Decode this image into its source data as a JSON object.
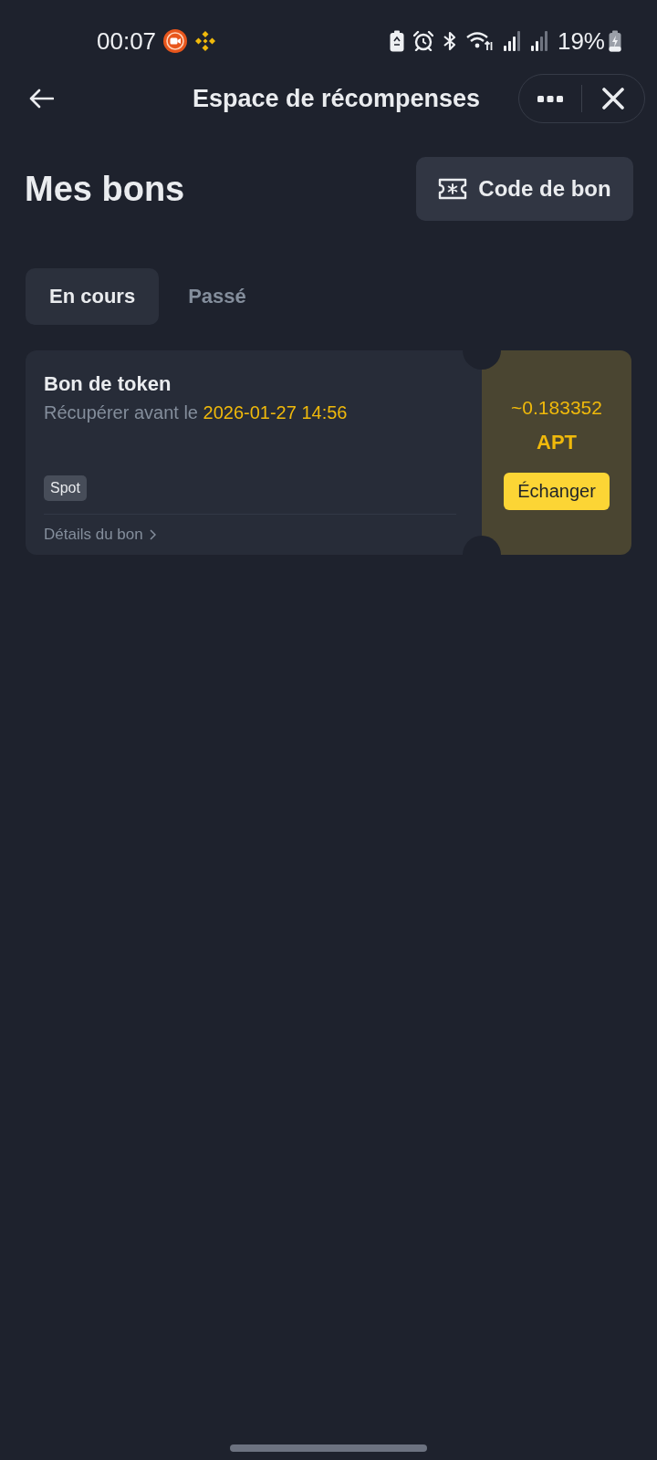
{
  "status_bar": {
    "time": "00:07",
    "battery": "19%"
  },
  "header": {
    "title": "Espace de récompenses"
  },
  "section": {
    "title": "Mes bons",
    "voucher_code_button": "Code de bon"
  },
  "tabs": [
    {
      "label": "En cours",
      "selected": true
    },
    {
      "label": "Passé",
      "selected": false
    }
  ],
  "vouchers": [
    {
      "title": "Bon de token",
      "expiry_label": "Récupérer avant le",
      "expiry": "2026-01-27 14:56",
      "tag": "Spot",
      "details_link": "Détails du bon",
      "amount": "~0.183352",
      "asset": "APT",
      "redeem_button": "Échanger"
    }
  ]
}
